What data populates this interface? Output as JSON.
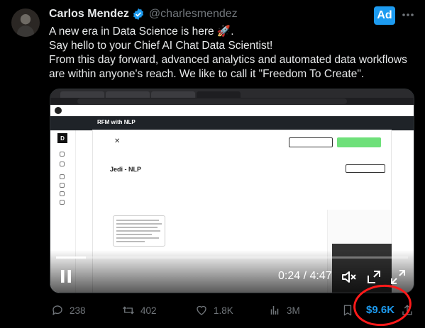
{
  "author": {
    "name": "Carlos Mendez",
    "handle": "@charlesmendez"
  },
  "ad_label": "Ad",
  "tweet_lines": [
    "A new era in Data Science is here 🚀.",
    "Say hello to your Chief AI Chat Data Scientist!",
    "From this day forward, advanced analytics and automated data workflows",
    "are within anyone's reach. We like to call it \"Freedom To Create\"."
  ],
  "video": {
    "app_title": "RFM with NLP",
    "panel_title": "Jedi - NLP",
    "sidebar_logo": "D",
    "current_time": "0:24",
    "duration": "4:47",
    "time_display": "0:24 / 4:47",
    "progress": 0.085
  },
  "actions": {
    "replies": "238",
    "reposts": "402",
    "likes": "1.8K",
    "views": "3M"
  },
  "earnings": "$9.6K",
  "colors": {
    "accent": "#1d9bf0",
    "annotation": "#ff1a1a",
    "muted": "#71767b"
  }
}
